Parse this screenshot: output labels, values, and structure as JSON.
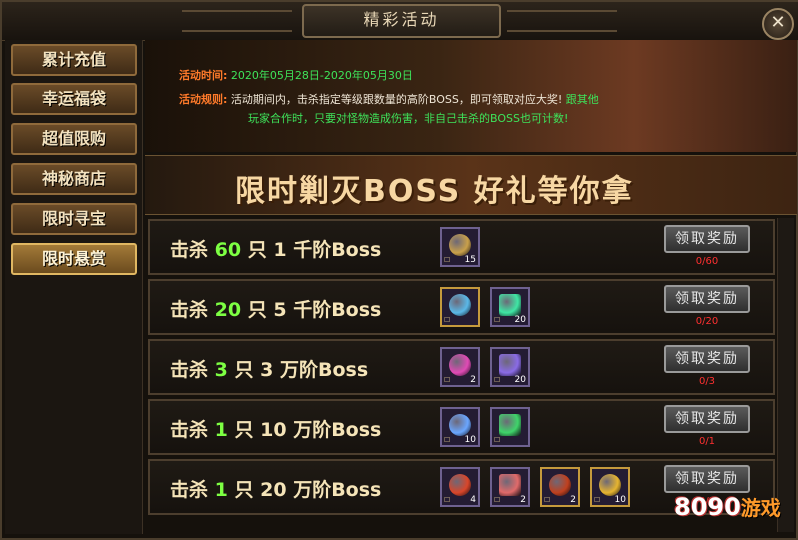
{
  "window": {
    "title": "精彩活动",
    "close": "✕"
  },
  "sidebar": {
    "items": [
      {
        "label": "累计充值"
      },
      {
        "label": "幸运福袋"
      },
      {
        "label": "超值限购"
      },
      {
        "label": "神秘商店"
      },
      {
        "label": "限时寻宝"
      },
      {
        "label": "限时悬赏",
        "active": true
      }
    ]
  },
  "activity": {
    "time_label": "活动时间:",
    "time_value": "2020年05月28日-2020年05月30日",
    "rule_label": "活动规则:",
    "rule_text_1": "活动期间内，击杀指定等级跟数量的高阶BOSS，即可领取对应大奖!",
    "rule_text_2": "跟其他",
    "rule_text_3": "玩家合作时，只要对怪物造成伤害，非自己击杀的BOSS也可计数!"
  },
  "hero_banner": {
    "text": "限时剿灭BOSS  好礼等你拿"
  },
  "tasks": [
    {
      "prefix": "击杀",
      "count": "60",
      "unit": "只",
      "boss": "1 千阶Boss",
      "rewards": [
        {
          "icon": "treasure-chest-icon",
          "qty": "15",
          "color": "#c9a04a",
          "border": "purple"
        }
      ],
      "claim": "领取奖励",
      "progress": "0/60"
    },
    {
      "prefix": "击杀",
      "count": "20",
      "unit": "只",
      "boss": "5 千阶Boss",
      "rewards": [
        {
          "icon": "compass-disc-icon",
          "qty": "",
          "color": "#5ab8e8",
          "border": "gold"
        },
        {
          "icon": "green-crystal-icon",
          "qty": "20",
          "color": "#3fe6a4",
          "border": "purple"
        }
      ],
      "claim": "领取奖励",
      "progress": "0/20"
    },
    {
      "prefix": "击杀",
      "count": "3",
      "unit": "只",
      "boss": "3 万阶Boss",
      "rewards": [
        {
          "icon": "pink-gem-icon",
          "qty": "2",
          "color": "#e04ab5",
          "border": "purple"
        },
        {
          "icon": "purple-crystal-icon",
          "qty": "20",
          "color": "#8a6be6",
          "border": "purple"
        }
      ],
      "claim": "领取奖励",
      "progress": "0/3"
    },
    {
      "prefix": "击杀",
      "count": "1",
      "unit": "只",
      "boss": "10 万阶Boss",
      "rewards": [
        {
          "icon": "feather-icon",
          "qty": "10",
          "color": "#6aa6ff",
          "border": "purple"
        },
        {
          "icon": "green-shard-icon",
          "qty": "",
          "color": "#3fd46a",
          "border": "purple"
        }
      ],
      "claim": "领取奖励",
      "progress": "0/1"
    },
    {
      "prefix": "击杀",
      "count": "1",
      "unit": "只",
      "boss": "20 万阶Boss",
      "rewards": [
        {
          "icon": "red-amulet-icon",
          "qty": "4",
          "color": "#d9462a",
          "border": "purple"
        },
        {
          "icon": "red-crystal-icon",
          "qty": "2",
          "color": "#e06a6a",
          "border": "purple"
        },
        {
          "icon": "red-orb-icon",
          "qty": "2",
          "color": "#c0401e",
          "border": "gold"
        },
        {
          "icon": "gold-coin-icon",
          "qty": "10",
          "color": "#e6b430",
          "border": "gold"
        }
      ],
      "claim": "领取奖励",
      "progress": "0/1"
    }
  ],
  "watermark": {
    "main": "8090",
    "sub": "游戏"
  },
  "colors": {
    "accent": "#ff7a2a",
    "rule_green": "#3ee35a",
    "count_green": "#7dff43",
    "progress_red": "#ff3030"
  }
}
